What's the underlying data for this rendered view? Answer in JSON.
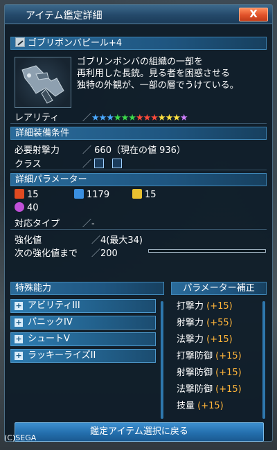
{
  "window": {
    "title": "アイテム鑑定詳細",
    "close_label": "X"
  },
  "item": {
    "name": "ゴブリボンバピール+4",
    "description": [
      "ゴブリンボンバの組織の一部を",
      "再利用した長銃。見る者を困惑させる",
      "独特の外観が、一部の層でうけている。"
    ]
  },
  "rarity": {
    "label": "レアリティ",
    "stars": 13,
    "star_colors": [
      "#4aa8ff",
      "#4aa8ff",
      "#4aa8ff",
      "#3bd94a",
      "#3bd94a",
      "#3bd94a",
      "#ff4a3a",
      "#ff4a3a",
      "#ff4a3a",
      "#ffe040",
      "#ffe040",
      "#ffe040",
      "#d080ff"
    ]
  },
  "requirements": {
    "header": "詳細装備条件",
    "power_label": "必要射撃力",
    "power_value": "660（現在の値 936）",
    "class_label": "クラス"
  },
  "params": {
    "header": "詳細パラメーター",
    "stat1": "15",
    "stat2": "1179",
    "stat3": "15",
    "stat4": "40",
    "type_label": "対応タイプ",
    "type_value": "-",
    "grind_label": "強化値",
    "grind_value": "4(最大34)",
    "next_label": "次の強化値まで",
    "next_value": "200",
    "next_progress": 0
  },
  "abilities": {
    "header": "特殊能力",
    "items": [
      "アビリティIII",
      "パニックIV",
      "シュートV",
      "ラッキーライズII"
    ]
  },
  "bonus": {
    "header": "パラメーター補正",
    "rows": [
      {
        "name": "打撃力",
        "value": "(+15)"
      },
      {
        "name": "射撃力",
        "value": "(+55)"
      },
      {
        "name": "法撃力",
        "value": "(+15)"
      },
      {
        "name": "打撃防御",
        "value": "(+15)"
      },
      {
        "name": "射撃防御",
        "value": "(+15)"
      },
      {
        "name": "法撃防御",
        "value": "(+15)"
      },
      {
        "name": "技量",
        "value": "(+15)"
      }
    ]
  },
  "back_button": "鑑定アイテム選択に戻る",
  "copyright": "(C)SEGA"
}
